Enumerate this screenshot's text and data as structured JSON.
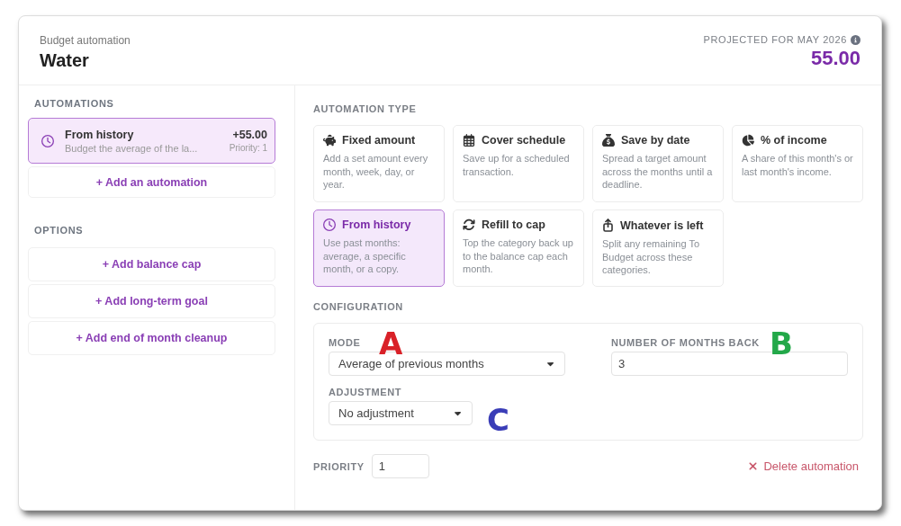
{
  "header": {
    "subtitle": "Budget automation",
    "title": "Water",
    "projected_label": "PROJECTED FOR MAY 2026",
    "projected_value": "55.00"
  },
  "sidebar": {
    "automations_heading": "AUTOMATIONS",
    "automations": [
      {
        "title": "From history",
        "amount": "+55.00",
        "description": "Budget the average of the la...",
        "priority": "Priority: 1",
        "selected": true
      }
    ],
    "add_automation": "+ Add an automation",
    "options_heading": "OPTIONS",
    "options": [
      "+ Add balance cap",
      "+ Add long-term goal",
      "+ Add end of month cleanup"
    ]
  },
  "automation_type": {
    "heading": "AUTOMATION TYPE",
    "types": [
      {
        "title": "Fixed amount",
        "description": "Add a set amount every month, week, day, or year.",
        "selected": false
      },
      {
        "title": "Cover schedule",
        "description": "Save up for a scheduled transaction.",
        "selected": false
      },
      {
        "title": "Save by date",
        "description": "Spread a target amount across the months until a deadline.",
        "selected": false
      },
      {
        "title": "% of income",
        "description": "A share of this month's or last month's income.",
        "selected": false
      },
      {
        "title": "From history",
        "description": "Use past months: average, a specific month, or a copy.",
        "selected": true
      },
      {
        "title": "Refill to cap",
        "description": "Top the category back up to the balance cap each month.",
        "selected": false
      },
      {
        "title": "Whatever is left",
        "description": "Split any remaining To Budget across these categories.",
        "selected": false
      }
    ]
  },
  "configuration": {
    "heading": "CONFIGURATION",
    "mode": {
      "label": "MODE",
      "value": "Average of previous months",
      "annotation": {
        "text": "A",
        "color": "#d92128"
      }
    },
    "months_back": {
      "label": "NUMBER OF MONTHS BACK",
      "value": "3",
      "annotation": {
        "text": "B",
        "color": "#23a849"
      }
    },
    "adjustment": {
      "label": "ADJUSTMENT",
      "value": "No adjustment",
      "annotation": {
        "text": "C",
        "color": "#3a3db7"
      }
    }
  },
  "footer": {
    "priority_label": "PRIORITY",
    "priority_value": "1",
    "delete": "Delete automation"
  }
}
